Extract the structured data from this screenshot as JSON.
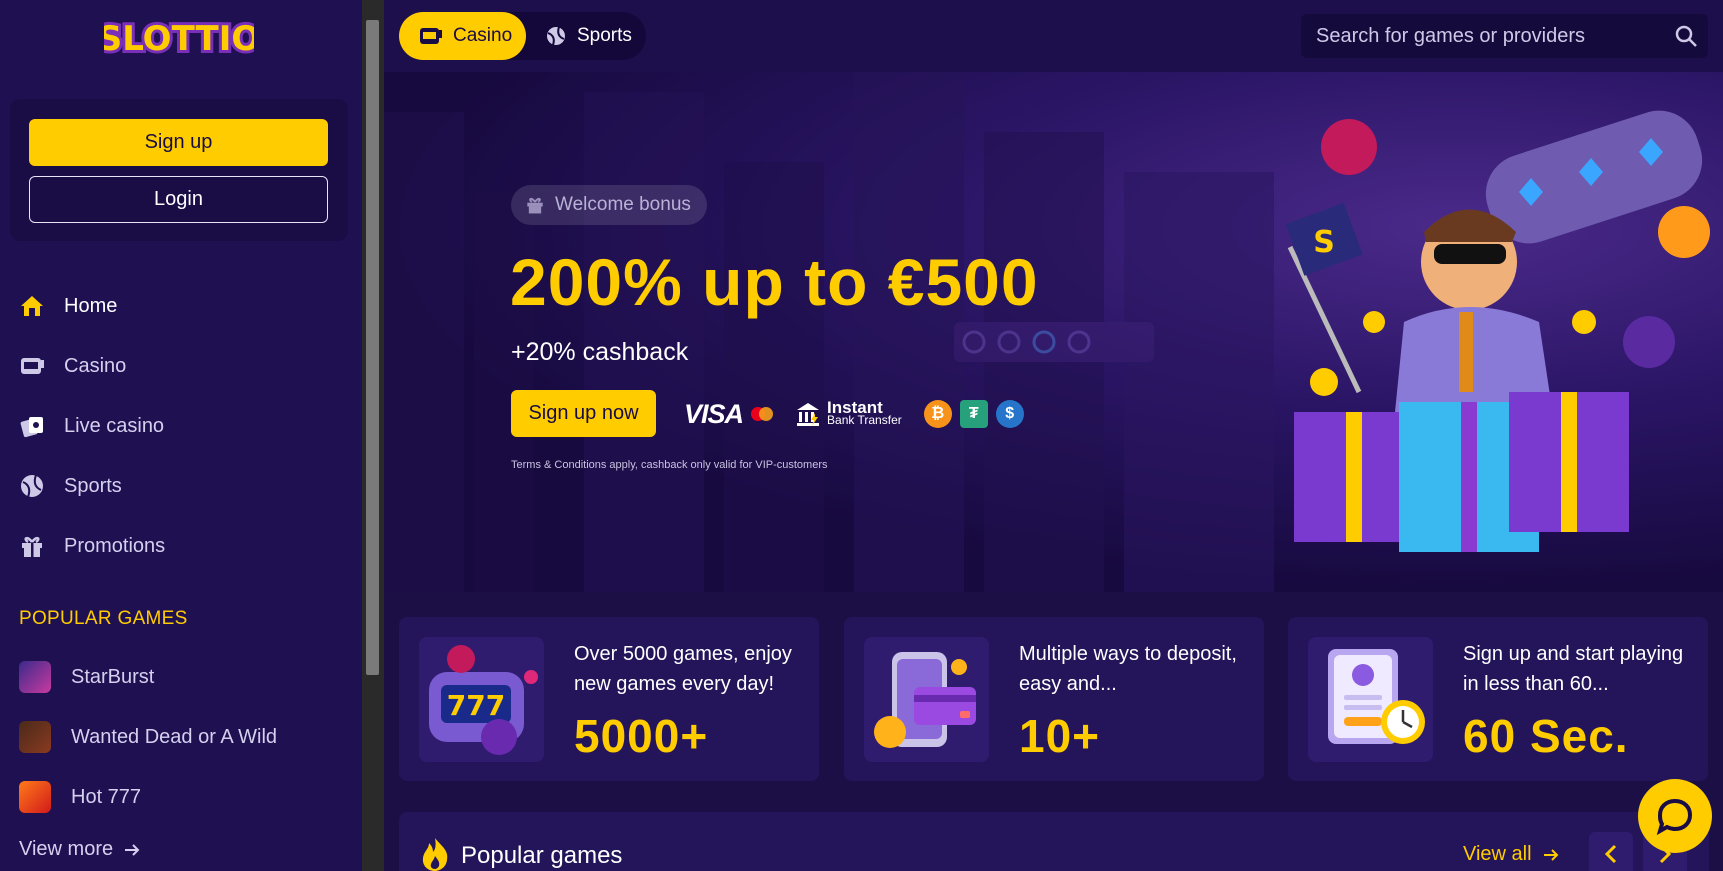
{
  "brand": {
    "logo_text": "SLOTTIO"
  },
  "auth": {
    "signup_label": "Sign up",
    "login_label": "Login"
  },
  "nav": {
    "items": [
      {
        "label": "Home",
        "icon": "home-icon"
      },
      {
        "label": "Casino",
        "icon": "slot-machine-icon"
      },
      {
        "label": "Live casino",
        "icon": "cards-icon"
      },
      {
        "label": "Sports",
        "icon": "ball-icon"
      },
      {
        "label": "Promotions",
        "icon": "gift-icon"
      }
    ]
  },
  "popular_sidebar": {
    "title": "POPULAR GAMES",
    "games": [
      {
        "label": "StarBurst"
      },
      {
        "label": "Wanted Dead or A Wild"
      },
      {
        "label": "Hot 777"
      }
    ],
    "view_more": "View more"
  },
  "topbar": {
    "tabs": [
      {
        "label": "Casino"
      },
      {
        "label": "Sports"
      }
    ],
    "search_placeholder": "Search for games or providers"
  },
  "hero": {
    "badge": "Welcome bonus",
    "title": "200% up to €500",
    "subtitle": "+20% cashback",
    "cta": "Sign up now",
    "payments": {
      "visa": "VISA",
      "instant_1": "Instant",
      "instant_2": "Bank Transfer"
    },
    "terms": "Terms & Conditions apply, cashback only valid for VIP-customers"
  },
  "stats": [
    {
      "text": "Over 5000 games, enjoy new games every day!",
      "number": "5000+"
    },
    {
      "text": "Multiple ways to deposit, easy and...",
      "number": "10+"
    },
    {
      "text": "Sign up and start playing in less than 60...",
      "number": "60 Sec."
    }
  ],
  "popular_games": {
    "title": "Popular games",
    "view_all": "View all"
  },
  "colors": {
    "accent": "#ffcc00",
    "background": "#1b0f45",
    "sidebar": "#1f1052",
    "card": "#241459"
  }
}
